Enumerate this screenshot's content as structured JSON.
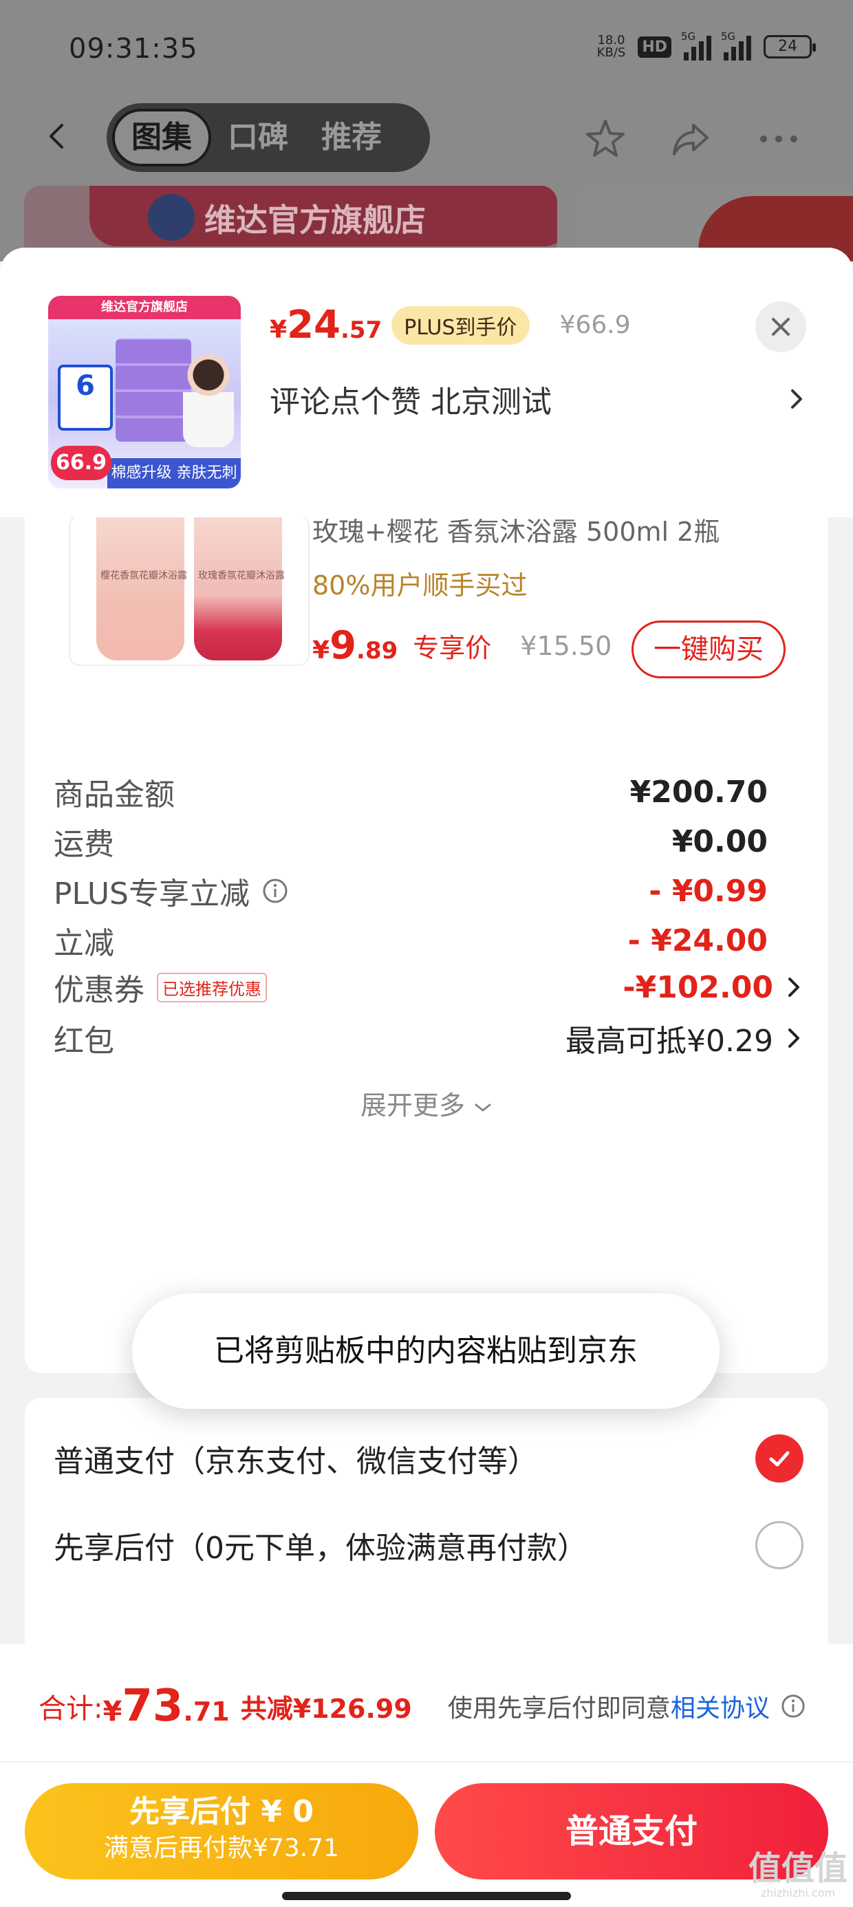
{
  "status_bar": {
    "time": "09:31:35",
    "net_speed_value": "18.0",
    "net_speed_unit": "KB/S",
    "hd": "HD",
    "sig1": "5G",
    "sig2": "5G",
    "battery": "24"
  },
  "nav": {
    "tabs": [
      {
        "label": "图集",
        "active": true
      },
      {
        "label": "口碑",
        "active": false
      },
      {
        "label": "推荐",
        "active": false
      }
    ]
  },
  "background": {
    "store_name": "维达官方旗舰店"
  },
  "product": {
    "thumb_store": "维达官方旗舰店",
    "thumb_count": "6",
    "thumb_price": "66.9",
    "thumb_slogan": "棉感升级 亲肤无刺激",
    "price_symbol": "¥",
    "price_int": "24",
    "price_dec": ".57",
    "plus_tag": "PLUS到手价",
    "original_price": "¥66.9",
    "spec": "评论点个赞  北京测试"
  },
  "recommend": {
    "bottle1_label": "樱花香氛花瓣沐浴露",
    "bottle2_label": "玫瑰香氛花瓣沐浴露",
    "title": "玫瑰+樱花 香氛沐浴露 500ml 2瓶",
    "buyers": "80%用户顺手买过",
    "price_symbol": "¥",
    "price_int": "9",
    "price_dec": ".89",
    "exclusive": "专享价",
    "original_price": "¥15.50",
    "buy_button": "一键购买"
  },
  "amounts": {
    "goods_label": "商品金额",
    "goods_value": "¥200.70",
    "shipping_label": "运费",
    "shipping_value": "¥0.00",
    "plus_label": "PLUS专享立减",
    "plus_value": "- ¥0.99",
    "instant_label": "立减",
    "instant_value": "- ¥24.00",
    "coupon_label": "优惠券",
    "coupon_tag": "已选推荐优惠",
    "coupon_value": "-¥102.00",
    "redpacket_label": "红包",
    "redpacket_value": "最高可抵¥0.29",
    "expand_more": "展开更多"
  },
  "payment": {
    "normal_label": "普通支付（京东支付、微信支付等）",
    "later_label": "先享后付（0元下单，体验满意再付款）"
  },
  "toast": {
    "text": "已将剪贴板中的内容粘贴到京东"
  },
  "footer": {
    "total_label": "合计:",
    "total_symbol": "¥",
    "total_int": "73",
    "total_dec": ".71",
    "total_discount": "共减¥126.99",
    "agree_text": "使用先享后付即同意",
    "agree_link": "相关协议",
    "later_button_line1": "先享后付 ¥ 0",
    "later_button_line2": "满意后再付款¥73.71",
    "pay_button": "普通支付"
  },
  "watermark": {
    "big": "值值值",
    "small": "zhizhizhi.com"
  },
  "colors": {
    "accent_red": "#e2231a",
    "plus_gold": "#fbe6a8",
    "later_yellow": "#f7a90c",
    "link_blue": "#1b63e0"
  }
}
